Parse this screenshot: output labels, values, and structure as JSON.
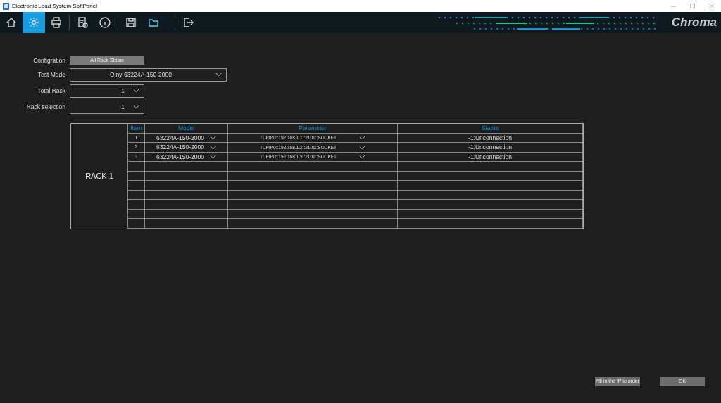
{
  "window": {
    "title": "Electronic Load System SoftPanel"
  },
  "toolbar": {
    "groups": [
      [
        {
          "selected": false
        },
        {
          "selected": true
        },
        {
          "selected": false
        }
      ],
      [
        {
          "selected": false
        },
        {
          "selected": false
        }
      ],
      [
        {
          "selected": false
        },
        {
          "selected": false
        }
      ],
      [
        {
          "selected": false
        }
      ]
    ]
  },
  "logo": "Chroma",
  "form": {
    "configuration": {
      "label": "Configration",
      "button": "All Rack Status"
    },
    "test_mode": {
      "label": "Test Mode",
      "value": "Olny 63224A-150-2000"
    },
    "total_rack": {
      "label": "Total Rack",
      "value": "1"
    },
    "rack_selection": {
      "label": "Rack selection",
      "value": "1"
    }
  },
  "table": {
    "rack_label": "RACK 1",
    "columns": [
      "Item",
      "Model",
      "Parameter",
      "Status"
    ],
    "rows": [
      {
        "item": "1",
        "model": "63224A-150-2000",
        "parameter": "TCPIP0::192.168.1.1::2101::SOCKET",
        "status": "-1:Unconnection"
      },
      {
        "item": "2",
        "model": "63224A-150-2000",
        "parameter": "TCPIP0::192.168.1.2::2101::SOCKET",
        "status": "-1:Unconnection"
      },
      {
        "item": "3",
        "model": "63224A-150-2000",
        "parameter": "TCPIP0::192.168.1.3::2101::SOCKET",
        "status": "-1:Unconnection"
      }
    ]
  },
  "buttons": [
    "Fill in the IP in order",
    "OK"
  ]
}
